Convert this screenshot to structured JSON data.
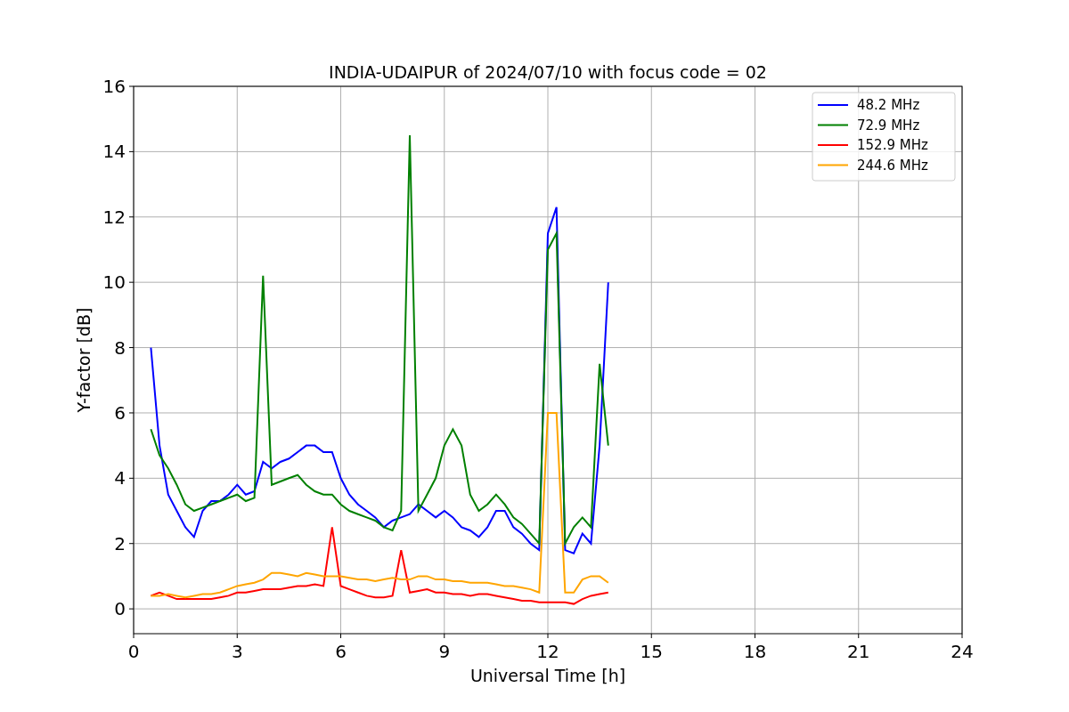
{
  "figure": {
    "chart_data": {
      "type": "line",
      "title": "INDIA-UDAIPUR of 2024/07/10 with focus code = 02",
      "xlabel": "Universal Time [h]",
      "ylabel": "Y-factor [dB]",
      "x": [
        0.5,
        0.75,
        1,
        1.25,
        1.5,
        1.75,
        2,
        2.25,
        2.5,
        2.75,
        3,
        3.25,
        3.5,
        3.75,
        4,
        4.25,
        4.5,
        4.75,
        5,
        5.25,
        5.5,
        5.75,
        6,
        6.25,
        6.5,
        6.75,
        7,
        7.25,
        7.5,
        7.75,
        8,
        8.25,
        8.5,
        8.75,
        9,
        9.25,
        9.5,
        9.75,
        10,
        10.25,
        10.5,
        10.75,
        11,
        11.25,
        11.5,
        11.75,
        12,
        12.25,
        12.5,
        12.75,
        13,
        13.25,
        13.5,
        13.75
      ],
      "series": [
        {
          "name": "48.2 MHz",
          "color": "#0000ff",
          "values": [
            8,
            5,
            3.5,
            3,
            2.5,
            2.2,
            3,
            3.3,
            3.3,
            3.5,
            3.8,
            3.5,
            3.6,
            4.5,
            4.3,
            4.5,
            4.6,
            4.8,
            5,
            5,
            4.8,
            4.8,
            4,
            3.5,
            3.2,
            3,
            2.8,
            2.5,
            2.7,
            2.8,
            2.9,
            3.2,
            3,
            2.8,
            3,
            2.8,
            2.5,
            2.4,
            2.2,
            2.5,
            3,
            3,
            2.5,
            2.3,
            2,
            1.8,
            11.5,
            12.3,
            1.8,
            1.7,
            2.3,
            2,
            5,
            10
          ]
        },
        {
          "name": "72.9 MHz",
          "color": "#008000",
          "values": [
            5.5,
            4.7,
            4.3,
            3.8,
            3.2,
            3,
            3.1,
            3.2,
            3.3,
            3.4,
            3.5,
            3.3,
            3.4,
            10.2,
            3.8,
            3.9,
            4,
            4.1,
            3.8,
            3.6,
            3.5,
            3.5,
            3.2,
            3,
            2.9,
            2.8,
            2.7,
            2.5,
            2.4,
            3,
            14.5,
            3,
            3.5,
            4,
            5,
            5.5,
            5,
            3.5,
            3,
            3.2,
            3.5,
            3.2,
            2.8,
            2.6,
            2.3,
            2,
            11,
            11.5,
            2,
            2.5,
            2.8,
            2.5,
            7.5,
            5
          ]
        },
        {
          "name": "152.9 MHz",
          "color": "#ff0000",
          "values": [
            0.4,
            0.5,
            0.4,
            0.3,
            0.3,
            0.3,
            0.3,
            0.3,
            0.35,
            0.4,
            0.5,
            0.5,
            0.55,
            0.6,
            0.6,
            0.6,
            0.65,
            0.7,
            0.7,
            0.75,
            0.7,
            2.5,
            0.7,
            0.6,
            0.5,
            0.4,
            0.35,
            0.35,
            0.4,
            1.8,
            0.5,
            0.55,
            0.6,
            0.5,
            0.5,
            0.45,
            0.45,
            0.4,
            0.45,
            0.45,
            0.4,
            0.35,
            0.3,
            0.25,
            0.25,
            0.2,
            0.2,
            0.2,
            0.2,
            0.15,
            0.3,
            0.4,
            0.45,
            0.5
          ]
        },
        {
          "name": "244.6 MHz",
          "color": "#ffa500",
          "values": [
            0.4,
            0.4,
            0.45,
            0.4,
            0.35,
            0.4,
            0.45,
            0.45,
            0.5,
            0.6,
            0.7,
            0.75,
            0.8,
            0.9,
            1.1,
            1.1,
            1.05,
            1,
            1.1,
            1.05,
            1,
            1,
            1,
            0.95,
            0.9,
            0.9,
            0.85,
            0.9,
            0.95,
            0.9,
            0.9,
            1,
            1,
            0.9,
            0.9,
            0.85,
            0.85,
            0.8,
            0.8,
            0.8,
            0.75,
            0.7,
            0.7,
            0.65,
            0.6,
            0.5,
            6,
            6,
            0.5,
            0.5,
            0.9,
            1,
            1,
            0.8
          ]
        }
      ],
      "grid": true,
      "legend": true,
      "xlim": [
        0,
        24
      ],
      "ylim": [
        -0.76,
        16
      ],
      "xticks": [
        0,
        3,
        6,
        9,
        12,
        15,
        18,
        21,
        24
      ],
      "yticks": [
        0,
        2,
        4,
        6,
        8,
        10,
        12,
        14,
        16
      ]
    }
  }
}
